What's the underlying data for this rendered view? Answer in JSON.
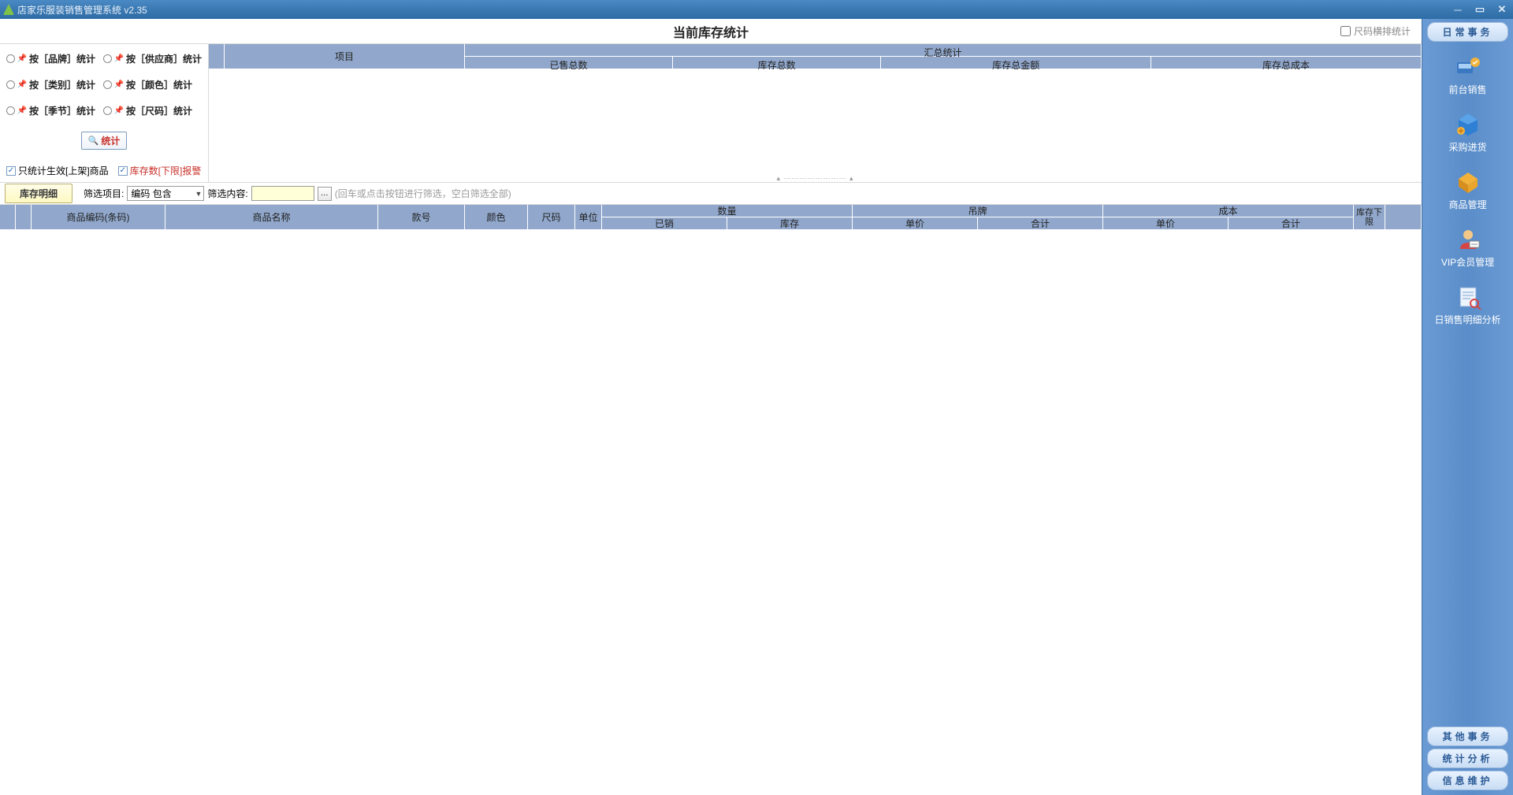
{
  "app": {
    "title": "店家乐服装销售管理系统 v2.35"
  },
  "page": {
    "title": "当前库存统计",
    "size_stat_label": "尺码横排统计"
  },
  "filters": {
    "by_brand": "按［品牌］统计",
    "by_supplier": "按［供应商］统计",
    "by_category": "按［类别］统计",
    "by_color": "按［颜色］统计",
    "by_season": "按［季节］统计",
    "by_size": "按［尺码］统计",
    "stats_btn": "统计",
    "only_on_shelf": "只统计生效[上架]商品",
    "stock_warn": "库存数[下限]报警"
  },
  "summary_table": {
    "col_project": "项目",
    "col_summary": "汇总统计",
    "col_sold_total": "已售总数",
    "col_stock_total": "库存总数",
    "col_stock_amount": "库存总金额",
    "col_stock_cost": "库存总成本"
  },
  "tab": {
    "detail": "库存明细"
  },
  "filter_row": {
    "label_item": "筛选项目:",
    "combo_value": "编码 包含",
    "label_content": "筛选内容:",
    "hint": "(回车或点击按钮进行筛选，空白筛选全部)"
  },
  "detail_table": {
    "col_code": "商品编码(条码)",
    "col_name": "商品名称",
    "col_style": "款号",
    "col_color": "颜色",
    "col_size": "尺码",
    "col_unit": "单位",
    "col_qty": "数量",
    "col_qty_sold": "已销",
    "col_qty_stock": "库存",
    "col_tag": "吊牌",
    "col_tag_price": "单价",
    "col_tag_total": "合计",
    "col_cost": "成本",
    "col_cost_price": "单价",
    "col_cost_total": "合计",
    "col_stock_limit": "库存下限"
  },
  "sidebar": {
    "header": "日常事务",
    "items": {
      "front_sales": "前台销售",
      "purchase": "采购进货",
      "goods_mgmt": "商品管理",
      "vip_mgmt": "VIP会员管理",
      "daily_sales_detail": "日销售明细分析"
    },
    "bottom": {
      "other": "其他事务",
      "stats": "统计分析",
      "maintain": "信息维护"
    }
  }
}
